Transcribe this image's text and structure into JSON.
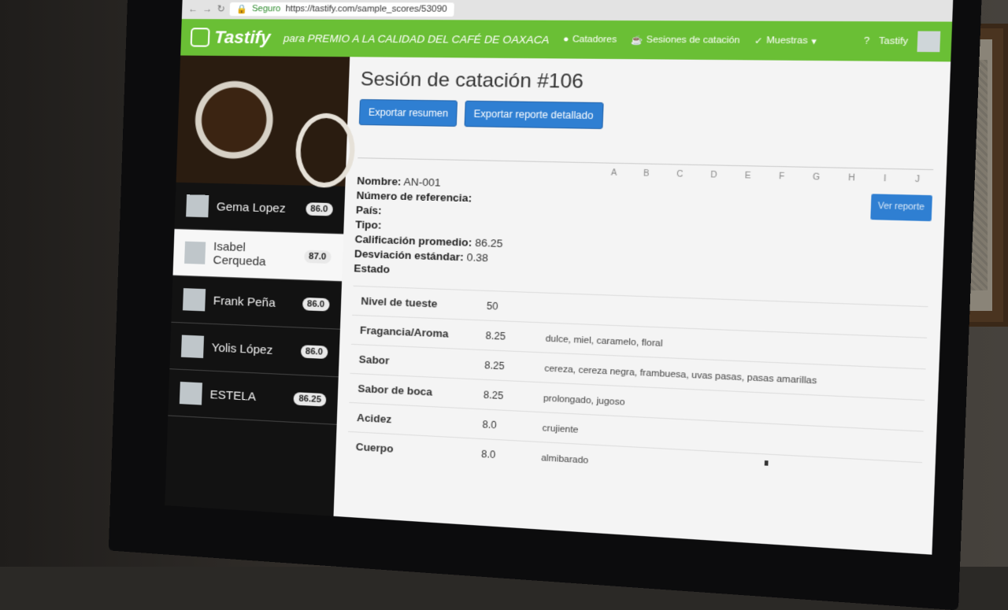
{
  "browser": {
    "secure_label": "Seguro",
    "url": "https://tastify.com/sample_scores/53090"
  },
  "nav": {
    "brand": "Tastify",
    "tagline": "para PREMIO A LA CALIDAD DEL CAFÉ DE OAXACA",
    "catadores": "Catadores",
    "sesiones": "Sesiones de catación",
    "muestras": "Muestras",
    "user": "Tastify"
  },
  "tasters": [
    {
      "name": "Gema Lopez",
      "score": "86.0"
    },
    {
      "name": "Isabel Cerqueda",
      "score": "87.0"
    },
    {
      "name": "Frank Peña",
      "score": "86.0"
    },
    {
      "name": "Yolis López",
      "score": "86.0"
    },
    {
      "name": "ESTELA",
      "score": "86.25"
    }
  ],
  "session": {
    "title": "Sesión de catación #106",
    "export_summary": "Exportar resumen",
    "export_detailed": "Exportar reporte detallado",
    "letters": "A B C D E F G H I J",
    "ver_reporte": "Ver reporte"
  },
  "sample": {
    "nombre_label": "Nombre:",
    "nombre": "AN-001",
    "referencia_label": "Número de referencia:",
    "pais_label": "País:",
    "tipo_label": "Tipo:",
    "calificacion_label": "Calificación promedio:",
    "calificacion": "86.25",
    "desviacion_label": "Desviación estándar:",
    "desviacion": "0.38",
    "estado_label": "Estado"
  },
  "attributes": [
    {
      "name": "Nivel de tueste",
      "value": "50",
      "desc": ""
    },
    {
      "name": "Fragancia/Aroma",
      "value": "8.25",
      "desc": "dulce, miel, caramelo, floral"
    },
    {
      "name": "Sabor",
      "value": "8.25",
      "desc": "cereza, cereza negra, frambuesa, uvas pasas, pasas amarillas"
    },
    {
      "name": "Sabor de boca",
      "value": "8.25",
      "desc": "prolongado, jugoso"
    },
    {
      "name": "Acidez",
      "value": "8.0",
      "desc": "crujiente"
    },
    {
      "name": "Cuerpo",
      "value": "8.0",
      "desc": "almibarado"
    }
  ]
}
